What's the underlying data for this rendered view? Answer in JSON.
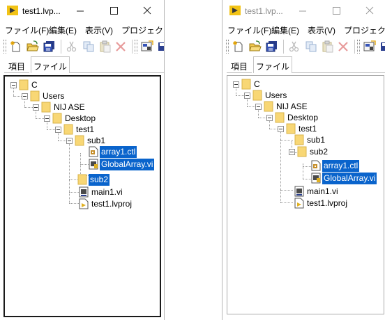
{
  "window_title": "test1.lvp...",
  "menu": [
    "ファイル(F)",
    "編集(E)",
    "表示(V)",
    "プロジェクト("
  ],
  "tabs": [
    "項目",
    "ファイル"
  ],
  "icons": {
    "app": "labview-project-icon",
    "new": "new-file-icon",
    "open": "open-folder-icon",
    "save": "save-all-icon",
    "cut": "cut-icon",
    "copy": "copy-icon",
    "paste": "paste-icon",
    "delete": "delete-icon",
    "build": "build-icon"
  },
  "colors": {
    "selection": "#0a64cc",
    "folder": "#f8d775"
  },
  "left_tree": {
    "c": "C",
    "users": "Users",
    "nij": "NIJ ASE",
    "desktop": "Desktop",
    "test1": "test1",
    "sub1": "sub1",
    "array1": "array1.ctl",
    "global": "GlobalArray.vi",
    "sub2": "sub2",
    "main1": "main1.vi",
    "proj": "test1.lvproj"
  },
  "right_tree": {
    "c": "C",
    "users": "Users",
    "nij": "NIJ ASE",
    "desktop": "Desktop",
    "test1": "test1",
    "sub1": "sub1",
    "sub2": "sub2",
    "array1": "array1.ctl",
    "global": "GlobalArray.vi",
    "main1": "main1.vi",
    "proj": "test1.lvproj"
  }
}
